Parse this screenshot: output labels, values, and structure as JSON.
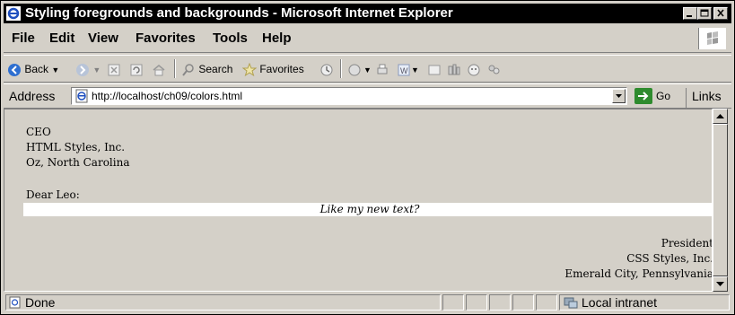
{
  "window": {
    "title": "Styling foregrounds and backgrounds - Microsoft Internet Explorer"
  },
  "menu": [
    "File",
    "Edit",
    "View",
    "Favorites",
    "Tools",
    "Help"
  ],
  "toolbar": {
    "back_label": "Back",
    "search_label": "Search",
    "favorites_label": "Favorites"
  },
  "address_bar": {
    "label": "Address",
    "url": "http://localhost/ch09/colors.html",
    "go_label": "Go",
    "links_label": "Links"
  },
  "page": {
    "recipient_lines": [
      "CEO",
      "HTML Styles, Inc.",
      "Oz, North Carolina"
    ],
    "greeting": "Dear Leo:",
    "highlight_text": "Like my new text?",
    "signature_lines": [
      "President",
      "CSS Styles, Inc.",
      "Emerald City, Pennsylvania"
    ]
  },
  "status": {
    "text": "Done",
    "zone": "Local intranet"
  },
  "colors": {
    "titlebar": "#000000",
    "chrome": "#d4d0c8",
    "highlight_bg": "#ffffff",
    "go_button": "#2e8b2e"
  }
}
